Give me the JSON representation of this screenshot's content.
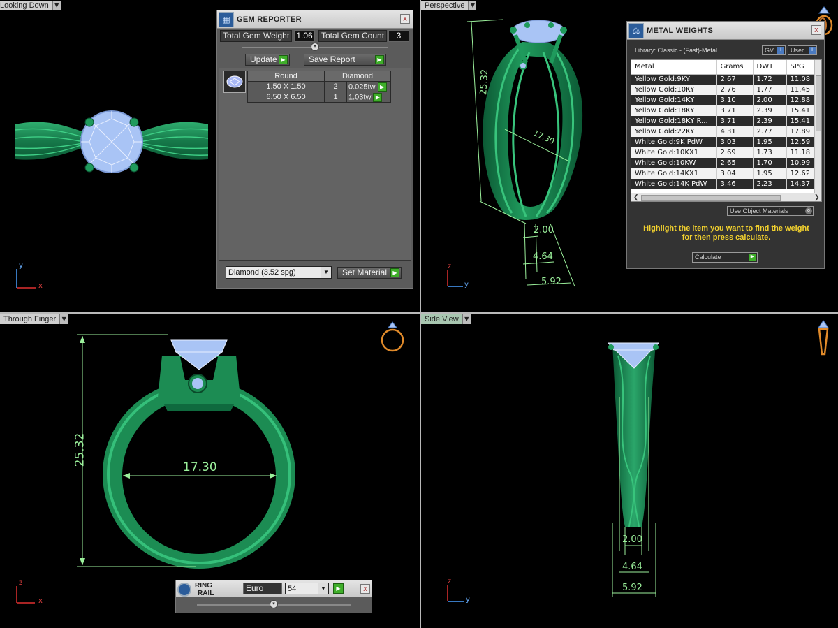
{
  "viewports": {
    "top_left": {
      "label": "Looking Down"
    },
    "top_right": {
      "label": "Perspective"
    },
    "bottom_left": {
      "label": "Through Finger"
    },
    "bottom_right": {
      "label": "Side View"
    }
  },
  "axes": {
    "x": "x",
    "y": "y",
    "z": "z"
  },
  "dimensions": {
    "height": "25.32",
    "inner_diameter": "17.30",
    "shank_inner": "2.00",
    "shank_mid": "4.64",
    "shank_outer": "5.92"
  },
  "gem_reporter": {
    "title": "GEM REPORTER",
    "close": "x",
    "total_weight_label": "Total Gem Weight",
    "total_weight_value": "1.06",
    "total_count_label": "Total Gem Count",
    "total_count_value": "3",
    "update_label": "Update",
    "save_report_label": "Save Report",
    "table_headers": [
      "Round",
      "Diamond"
    ],
    "rows": [
      {
        "size": "1.50 X 1.50",
        "count": "2",
        "weight": "0.025tw"
      },
      {
        "size": "6.50 X 6.50",
        "count": "1",
        "weight": "1.03tw"
      }
    ],
    "material_select": "Diamond      (3.52 spg)",
    "set_material_label": "Set Material"
  },
  "metal_weights": {
    "title": "METAL WEIGHTS",
    "close": "x",
    "library": "Library: Classic - (Fast)-Metal",
    "gv_label": "GV",
    "user_label": "User",
    "columns": [
      "Metal",
      "Grams",
      "DWT",
      "SPG"
    ],
    "rows": [
      [
        "Yellow Gold:9KY",
        "2.67",
        "1.72",
        "11.08"
      ],
      [
        "Yellow Gold:10KY",
        "2.76",
        "1.77",
        "11.45"
      ],
      [
        "Yellow Gold:14KY",
        "3.10",
        "2.00",
        "12.88"
      ],
      [
        "Yellow Gold:18KY",
        "3.71",
        "2.39",
        "15.41"
      ],
      [
        "Yellow Gold:18KY R...",
        "3.71",
        "2.39",
        "15.41"
      ],
      [
        "Yellow Gold:22KY",
        "4.31",
        "2.77",
        "17.89"
      ],
      [
        "White Gold:9K PdW",
        "3.03",
        "1.95",
        "12.59"
      ],
      [
        "White Gold:10KX1",
        "2.69",
        "1.73",
        "11.18"
      ],
      [
        "White Gold:10KW",
        "2.65",
        "1.70",
        "10.99"
      ],
      [
        "White Gold:14KX1",
        "3.04",
        "1.95",
        "12.62"
      ],
      [
        "White Gold:14K PdW",
        "3.46",
        "2.23",
        "14.37"
      ]
    ],
    "use_object_materials": "Use Object Materials",
    "instruction_line1": "Highlight the item you want to find the weight",
    "instruction_line2": "for then press calculate.",
    "calculate_label": "Calculate"
  },
  "ring_rail": {
    "title_line1": "RING",
    "title_line2": "RAIL",
    "standard": "Euro",
    "size": "54",
    "close": "x"
  },
  "colors": {
    "metal": "#1f8a55",
    "gem": "#a9c4f5",
    "dimension": "#9bf09b",
    "instruction": "#f2d12e"
  }
}
